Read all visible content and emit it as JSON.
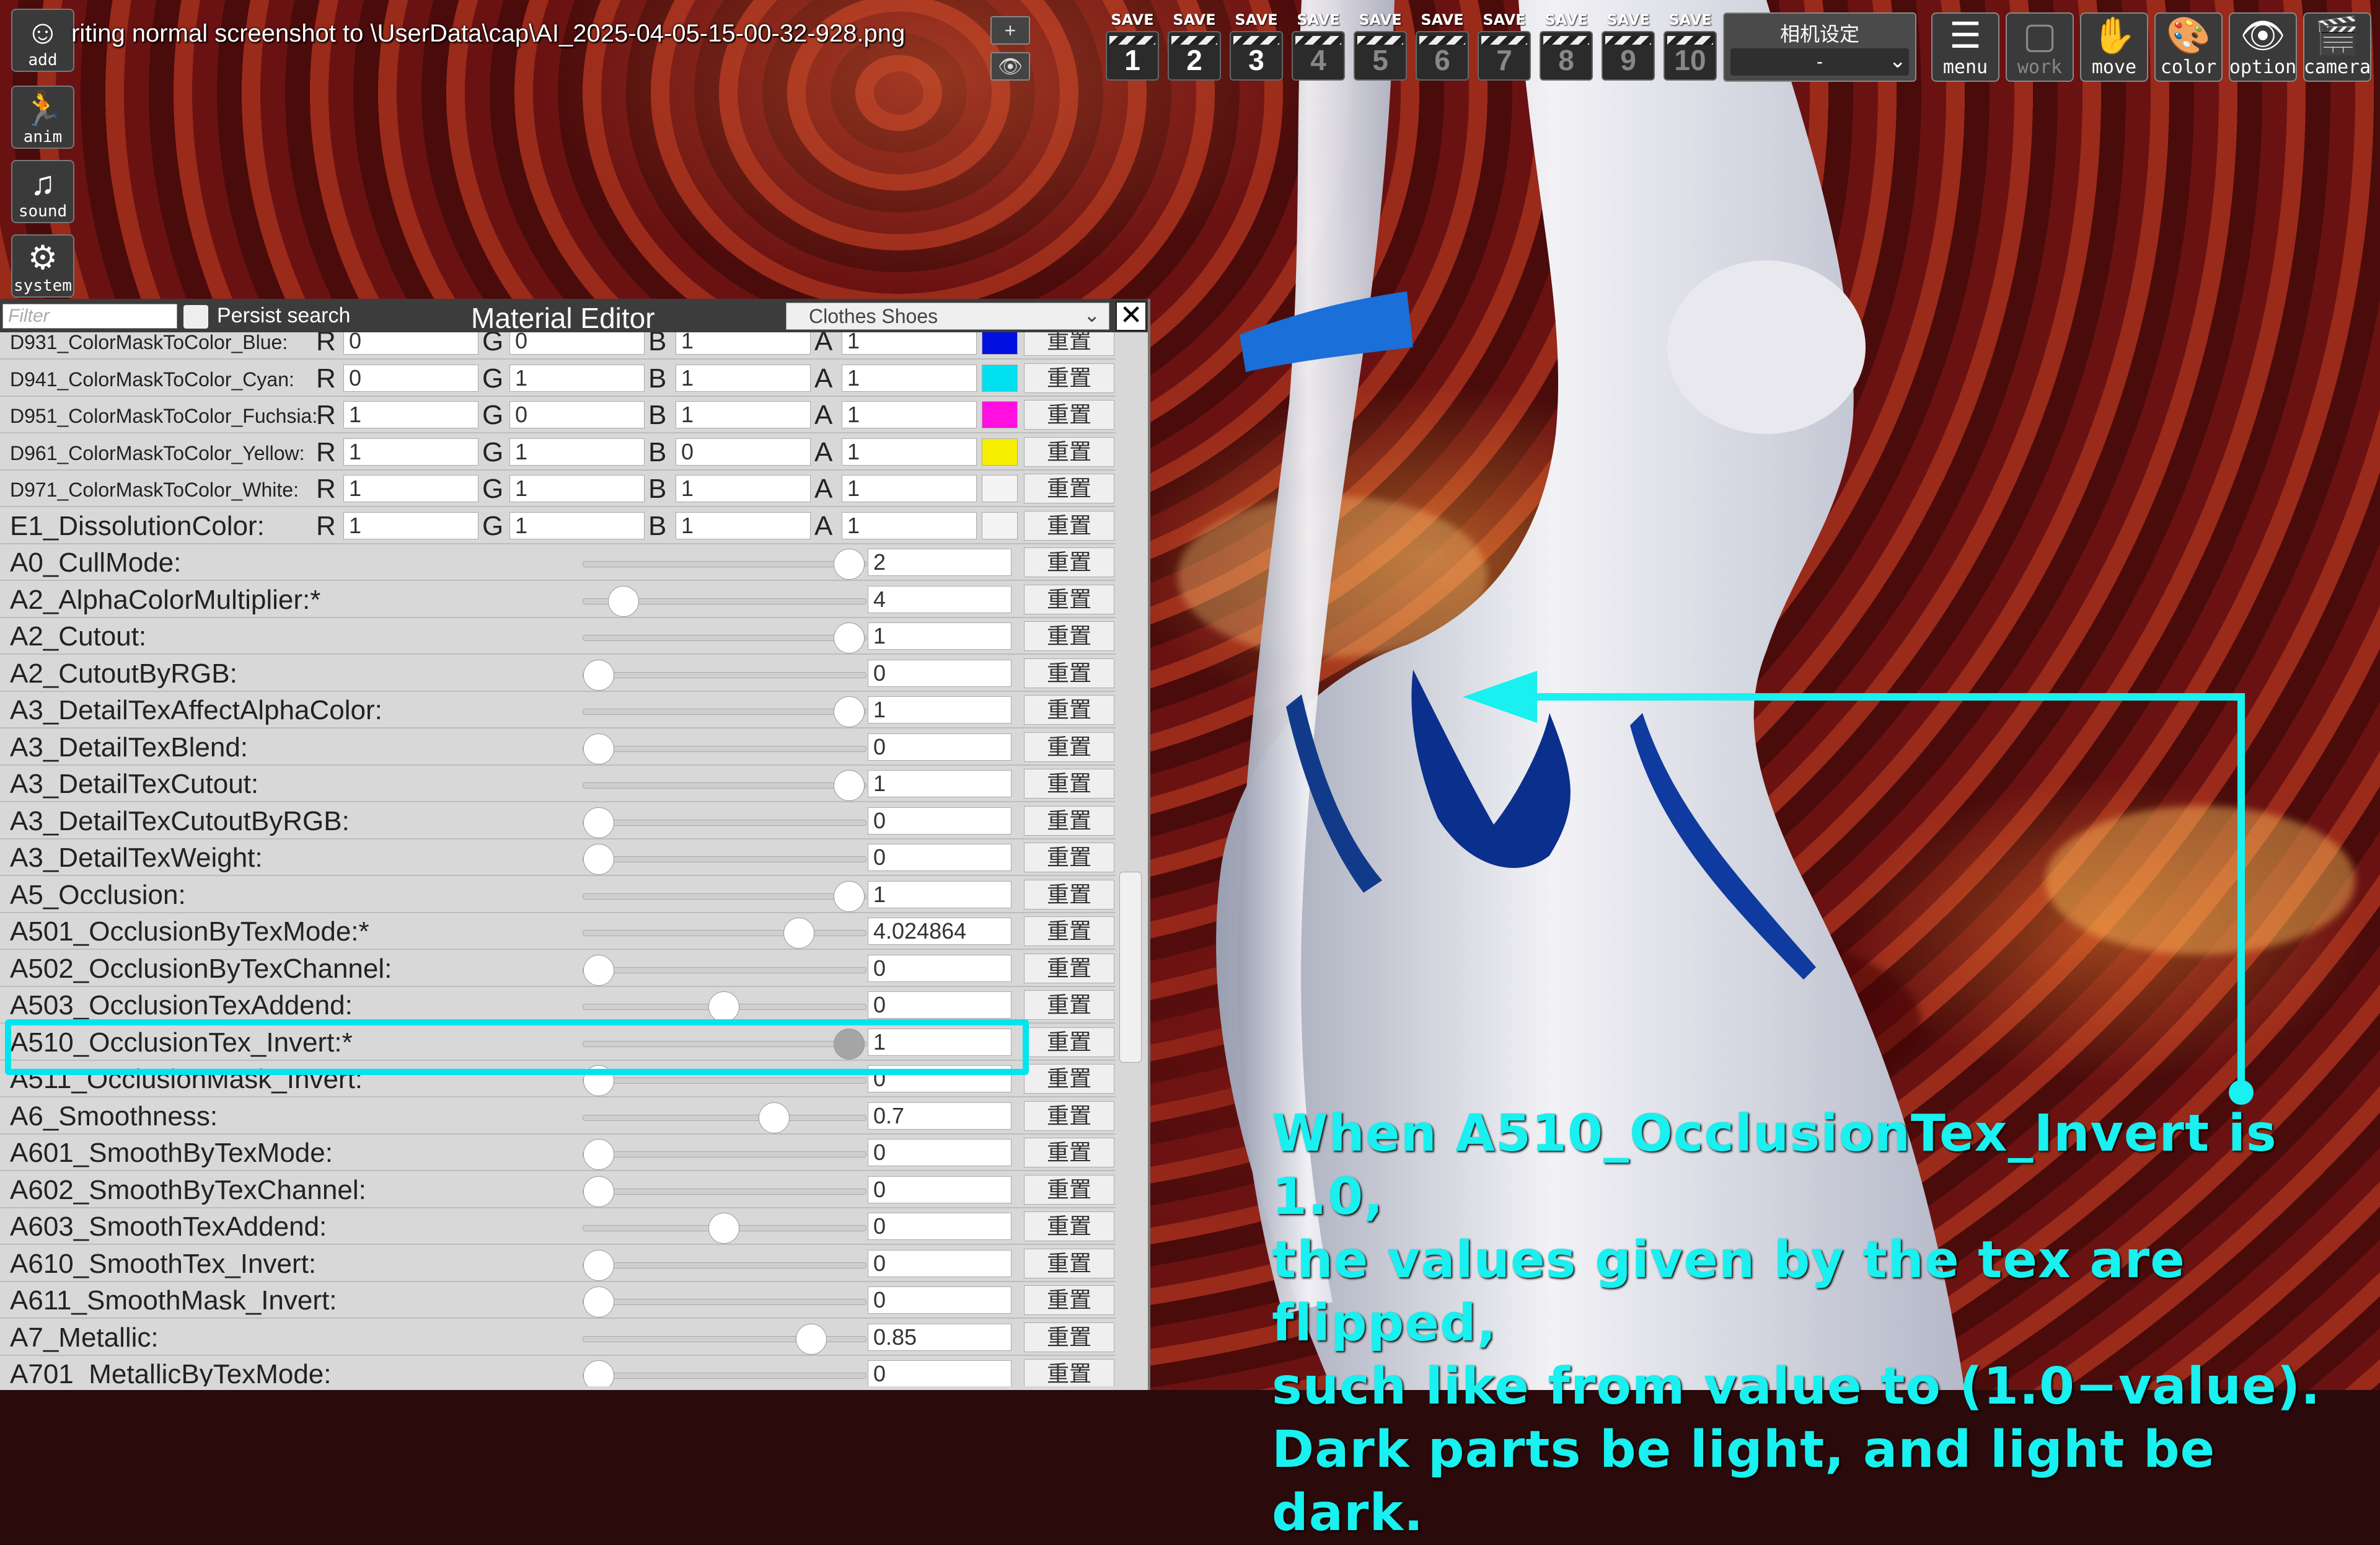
{
  "toolbar_left": [
    {
      "id": "add",
      "label": "add",
      "icon": "person-add-icon",
      "glyph": "☺"
    },
    {
      "id": "anim",
      "label": "anim",
      "icon": "running-figure-icon",
      "glyph": "🏃"
    },
    {
      "id": "sound",
      "label": "sound",
      "icon": "music-note-icon",
      "glyph": "♫"
    },
    {
      "id": "system",
      "label": "system",
      "icon": "gears-icon",
      "glyph": "⚙"
    }
  ],
  "status_text": "riting normal screenshot to \\UserData\\cap\\AI_2025-04-05-15-00-32-928.png",
  "mini_buttons": {
    "plus": "+",
    "eye": "👁"
  },
  "save_slots": {
    "caption": "SAVE",
    "numbers": [
      "1",
      "2",
      "3",
      "4",
      "5",
      "6",
      "7",
      "8",
      "9",
      "10"
    ]
  },
  "camera_setting": {
    "title": "相机设定",
    "value": "-"
  },
  "toolbar_right": [
    {
      "id": "menu",
      "label": "menu",
      "icon": "list-icon",
      "glyph": "☰"
    },
    {
      "id": "work",
      "label": "work",
      "icon": "window-icon",
      "glyph": "▢"
    },
    {
      "id": "move",
      "label": "move",
      "icon": "hand-icon",
      "glyph": "✋"
    },
    {
      "id": "color",
      "label": "color",
      "icon": "palette-icon",
      "glyph": "🎨"
    },
    {
      "id": "option",
      "label": "option",
      "icon": "eye-icon",
      "glyph": "👁"
    },
    {
      "id": "camera",
      "label": "camera",
      "icon": "clapper-camera-icon",
      "glyph": "🎬"
    }
  ],
  "editor": {
    "filter_placeholder": "Filter",
    "persist_label": "Persist search",
    "title": "Material Editor",
    "object_select": "Clothes Shoes",
    "reset_label": "重置",
    "color_rows": [
      {
        "name": "D931_ColorMaskToColor_Blue:",
        "r": "0",
        "g": "0",
        "b": "1",
        "a": "1",
        "swatch": "#0010e0"
      },
      {
        "name": "D941_ColorMaskToColor_Cyan:",
        "r": "0",
        "g": "1",
        "b": "1",
        "a": "1",
        "swatch": "#00e0ee"
      },
      {
        "name": "D951_ColorMaskToColor_Fuchsia:",
        "r": "1",
        "g": "0",
        "b": "1",
        "a": "1",
        "swatch": "#ff10e0"
      },
      {
        "name": "D961_ColorMaskToColor_Yellow:",
        "r": "1",
        "g": "1",
        "b": "0",
        "a": "1",
        "swatch": "#f6f000"
      },
      {
        "name": "D971_ColorMaskToColor_White:",
        "r": "1",
        "g": "1",
        "b": "1",
        "a": "1",
        "swatch": "#f4f4f4"
      },
      {
        "name": "E1_DissolutionColor:",
        "r": "1",
        "g": "1",
        "b": "1",
        "a": "1",
        "swatch": "#f4f4f4"
      }
    ],
    "float_rows": [
      {
        "name": "A0_CullMode:",
        "value": "2",
        "level": 1.0
      },
      {
        "name": "A2_AlphaColorMultiplier:*",
        "value": "4",
        "level": 0.1
      },
      {
        "name": "A2_Cutout:",
        "value": "1",
        "level": 1.0
      },
      {
        "name": "A2_CutoutByRGB:",
        "value": "0",
        "level": 0.0
      },
      {
        "name": "A3_DetailTexAffectAlphaColor:",
        "value": "1",
        "level": 1.0
      },
      {
        "name": "A3_DetailTexBlend:",
        "value": "0",
        "level": 0.0
      },
      {
        "name": "A3_DetailTexCutout:",
        "value": "1",
        "level": 1.0
      },
      {
        "name": "A3_DetailTexCutoutByRGB:",
        "value": "0",
        "level": 0.0
      },
      {
        "name": "A3_DetailTexWeight:",
        "value": "0",
        "level": 0.0
      },
      {
        "name": "A5_Occlusion:",
        "value": "1",
        "level": 1.0
      },
      {
        "name": "A501_OcclusionByTexMode:*",
        "value": "4.024864",
        "level": 0.8
      },
      {
        "name": "A502_OcclusionByTexChannel:",
        "value": "0",
        "level": 0.0
      },
      {
        "name": "A503_OcclusionTexAddend:",
        "value": "0",
        "level": 0.5
      },
      {
        "name": "A510_OcclusionTex_Invert:*",
        "value": "1",
        "level": 1.0
      },
      {
        "name": "A511_OcclusionMask_Invert:",
        "value": "0",
        "level": 0.0
      },
      {
        "name": "A6_Smoothness:",
        "value": "0.7",
        "level": 0.7
      },
      {
        "name": "A601_SmoothByTexMode:",
        "value": "0",
        "level": 0.0
      },
      {
        "name": "A602_SmoothByTexChannel:",
        "value": "0",
        "level": 0.0
      },
      {
        "name": "A603_SmoothTexAddend:",
        "value": "0",
        "level": 0.5
      },
      {
        "name": "A610_SmoothTex_Invert:",
        "value": "0",
        "level": 0.0
      },
      {
        "name": "A611_SmoothMask_Invert:",
        "value": "0",
        "level": 0.0
      },
      {
        "name": "A7_Metallic:",
        "value": "0.85",
        "level": 0.85
      },
      {
        "name": "A701_MetallicByTexMode:",
        "value": "0",
        "level": 0.0
      }
    ],
    "highlighted_row": "A510_OcclusionTex_Invert:*"
  },
  "annotation": {
    "color": "#19f0f0",
    "lines": [
      "When A510_OcclusionTex_Invert is 1.0,",
      "the values given by the tex are flipped,",
      "such like from value to (1.0−value).",
      "Dark parts be light, and light be dark."
    ]
  }
}
